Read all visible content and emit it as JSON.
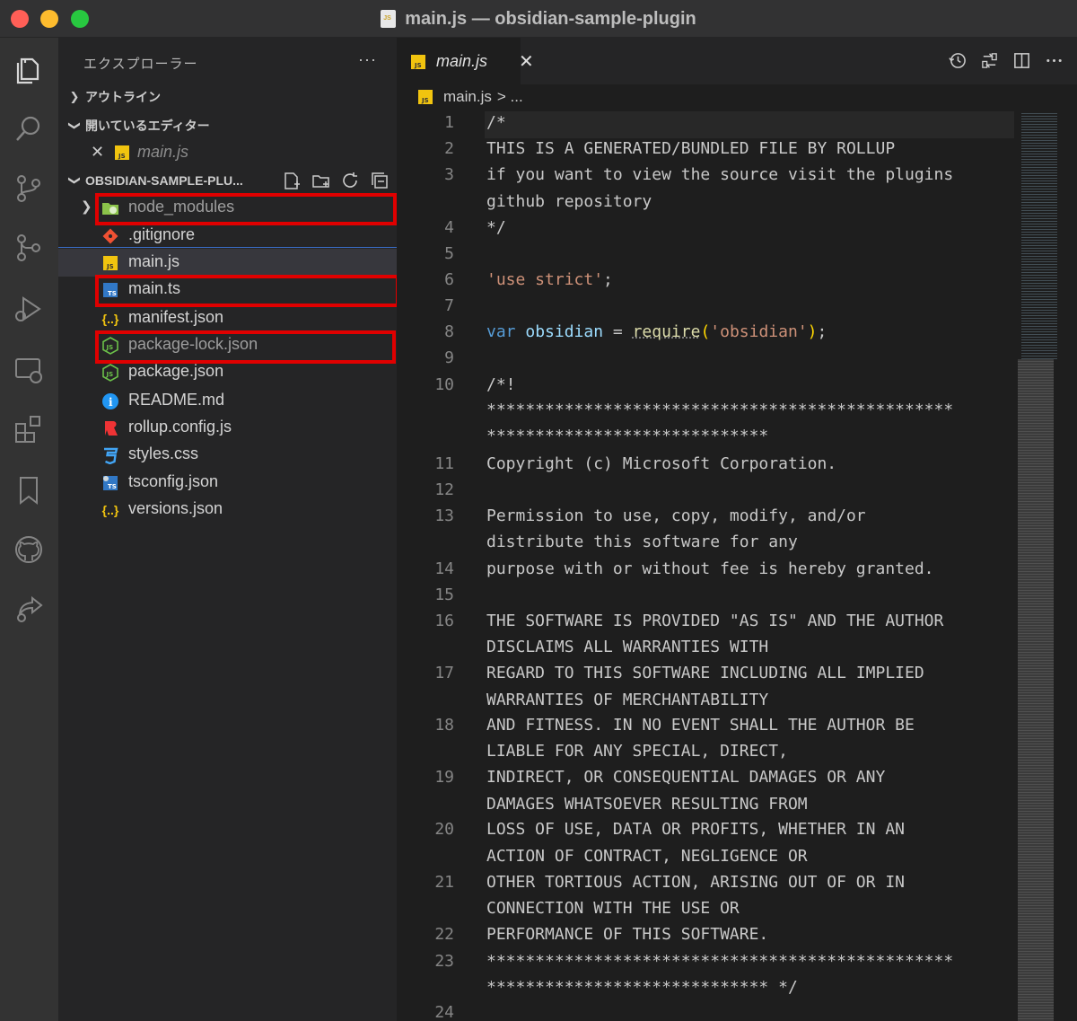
{
  "window": {
    "title": "main.js — obsidian-sample-plugin"
  },
  "activity_bar": [
    {
      "name": "explorer-icon"
    },
    {
      "name": "search-icon"
    },
    {
      "name": "source-control-icon"
    },
    {
      "name": "git-graph-icon"
    },
    {
      "name": "run-debug-icon"
    },
    {
      "name": "remote-explorer-icon"
    },
    {
      "name": "extensions-icon"
    },
    {
      "name": "bookmark-icon"
    },
    {
      "name": "github-icon"
    },
    {
      "name": "live-share-icon"
    }
  ],
  "sidebar": {
    "title": "エクスプローラー",
    "more": "···",
    "outline_label": "アウトライン",
    "open_editors_label": "開いているエディター",
    "open_editors": [
      {
        "name": "main.js"
      }
    ],
    "project_label": "OBSIDIAN-SAMPLE-PLU...",
    "files": [
      {
        "name": "node_modules",
        "icon": "folder-node-icon"
      },
      {
        "name": ".gitignore",
        "icon": "git-icon"
      },
      {
        "name": "main.js",
        "icon": "js-icon"
      },
      {
        "name": "main.ts",
        "icon": "ts-icon"
      },
      {
        "name": "manifest.json",
        "icon": "json-icon"
      },
      {
        "name": "package-lock.json",
        "icon": "node-icon"
      },
      {
        "name": "package.json",
        "icon": "node-icon"
      },
      {
        "name": "README.md",
        "icon": "info-icon"
      },
      {
        "name": "rollup.config.js",
        "icon": "rollup-icon"
      },
      {
        "name": "styles.css",
        "icon": "css-icon"
      },
      {
        "name": "tsconfig.json",
        "icon": "tsconfig-icon"
      },
      {
        "name": "versions.json",
        "icon": "json-icon"
      }
    ]
  },
  "editor": {
    "tab_label": "main.js",
    "breadcrumb_file": "main.js",
    "breadcrumb_rest": "> ...",
    "lines": [
      {
        "n": "1",
        "t": "/*"
      },
      {
        "n": "2",
        "t": "THIS IS A GENERATED/BUNDLED FILE BY ROLLUP"
      },
      {
        "n": "3",
        "t": "if you want to view the source visit the plugins"
      },
      {
        "n": "",
        "t": "github repository"
      },
      {
        "n": "4",
        "t": "*/"
      },
      {
        "n": "5",
        "t": ""
      },
      {
        "n": "6",
        "t": "'use strict';"
      },
      {
        "n": "7",
        "t": ""
      },
      {
        "n": "8",
        "t": "var obsidian = require('obsidian');"
      },
      {
        "n": "9",
        "t": ""
      },
      {
        "n": "10",
        "t": "/*!"
      },
      {
        "n": "",
        "t": "************************************************"
      },
      {
        "n": "",
        "t": "*****************************"
      },
      {
        "n": "11",
        "t": "Copyright (c) Microsoft Corporation."
      },
      {
        "n": "12",
        "t": ""
      },
      {
        "n": "13",
        "t": "Permission to use, copy, modify, and/or"
      },
      {
        "n": "",
        "t": "distribute this software for any"
      },
      {
        "n": "14",
        "t": "purpose with or without fee is hereby granted."
      },
      {
        "n": "15",
        "t": ""
      },
      {
        "n": "16",
        "t": "THE SOFTWARE IS PROVIDED \"AS IS\" AND THE AUTHOR"
      },
      {
        "n": "",
        "t": "DISCLAIMS ALL WARRANTIES WITH"
      },
      {
        "n": "17",
        "t": "REGARD TO THIS SOFTWARE INCLUDING ALL IMPLIED"
      },
      {
        "n": "",
        "t": "WARRANTIES OF MERCHANTABILITY"
      },
      {
        "n": "18",
        "t": "AND FITNESS. IN NO EVENT SHALL THE AUTHOR BE"
      },
      {
        "n": "",
        "t": "LIABLE FOR ANY SPECIAL, DIRECT,"
      },
      {
        "n": "19",
        "t": "INDIRECT, OR CONSEQUENTIAL DAMAGES OR ANY"
      },
      {
        "n": "",
        "t": "DAMAGES WHATSOEVER RESULTING FROM"
      },
      {
        "n": "20",
        "t": "LOSS OF USE, DATA OR PROFITS, WHETHER IN AN"
      },
      {
        "n": "",
        "t": "ACTION OF CONTRACT, NEGLIGENCE OR"
      },
      {
        "n": "21",
        "t": "OTHER TORTIOUS ACTION, ARISING OUT OF OR IN"
      },
      {
        "n": "",
        "t": "CONNECTION WITH THE USE OR"
      },
      {
        "n": "22",
        "t": "PERFORMANCE OF THIS SOFTWARE."
      },
      {
        "n": "23",
        "t": "************************************************"
      },
      {
        "n": "",
        "t": "***************************** */"
      },
      {
        "n": "24",
        "t": ""
      }
    ]
  },
  "colors": {
    "highlight_box": "#e00000",
    "js_icon": "#f1c40f",
    "ts_icon": "#3178c6",
    "node_icon": "#6cc24a",
    "git_icon": "#f05133"
  }
}
